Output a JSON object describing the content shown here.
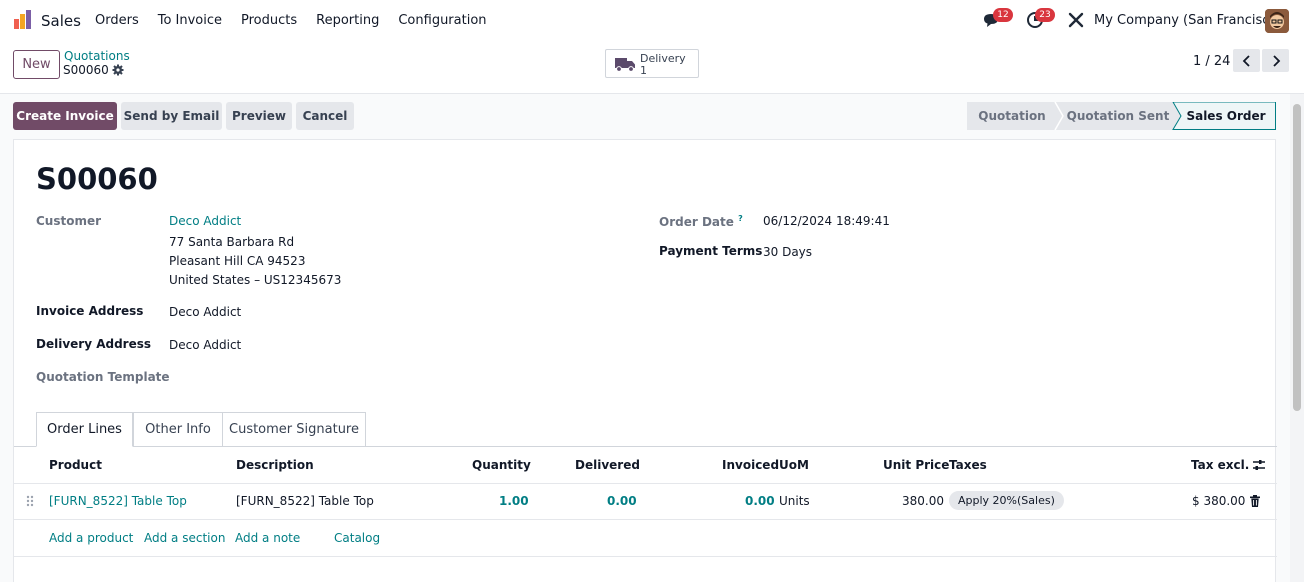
{
  "navbar": {
    "app_name": "Sales",
    "menu": [
      "Orders",
      "To Invoice",
      "Products",
      "Reporting",
      "Configuration"
    ],
    "messages_badge": "12",
    "activities_badge": "23",
    "company": "My Company (San Francisco)"
  },
  "control": {
    "new_label": "New",
    "breadcrumb_parent": "Quotations",
    "breadcrumb_current": "S00060",
    "delivery_label": "Delivery",
    "delivery_count": "1",
    "pager": "1 / 24"
  },
  "actions": {
    "create_invoice": "Create Invoice",
    "send_email": "Send by Email",
    "preview": "Preview",
    "cancel": "Cancel"
  },
  "status": {
    "stages": [
      "Quotation",
      "Quotation Sent",
      "Sales Order"
    ],
    "active": "Sales Order"
  },
  "form": {
    "title": "S00060",
    "customer_label": "Customer",
    "customer_name": "Deco Addict",
    "customer_address": [
      "77 Santa Barbara Rd",
      "Pleasant Hill CA 94523",
      "United States – US12345673"
    ],
    "invoice_address_label": "Invoice Address",
    "invoice_address": "Deco Addict",
    "delivery_address_label": "Delivery Address",
    "delivery_address": "Deco Addict",
    "quotation_template_label": "Quotation Template",
    "order_date_label": "Order Date",
    "order_date_help": "?",
    "order_date": "06/12/2024 18:49:41",
    "payment_terms_label": "Payment Terms",
    "payment_terms": "30 Days"
  },
  "tabs": [
    "Order Lines",
    "Other Info",
    "Customer Signature"
  ],
  "lines": {
    "headers": {
      "product": "Product",
      "description": "Description",
      "quantity": "Quantity",
      "delivered": "Delivered",
      "invoiced": "Invoiced",
      "uom": "UoM",
      "unit_price": "Unit Price",
      "taxes": "Taxes",
      "tax_excl": "Tax excl."
    },
    "rows": [
      {
        "product": "[FURN_8522] Table Top",
        "description": "[FURN_8522] Table Top",
        "quantity": "1.00",
        "delivered": "0.00",
        "invoiced": "0.00",
        "uom": "Units",
        "unit_price": "380.00",
        "tax": "Apply 20%(Sales)",
        "subtotal": "$ 380.00"
      }
    ],
    "add_links": [
      "Add a product",
      "Add a section",
      "Add a note",
      "Catalog"
    ]
  },
  "colors": {
    "brand": "#714b67",
    "link": "#017e84",
    "badge": "#d9363e"
  }
}
